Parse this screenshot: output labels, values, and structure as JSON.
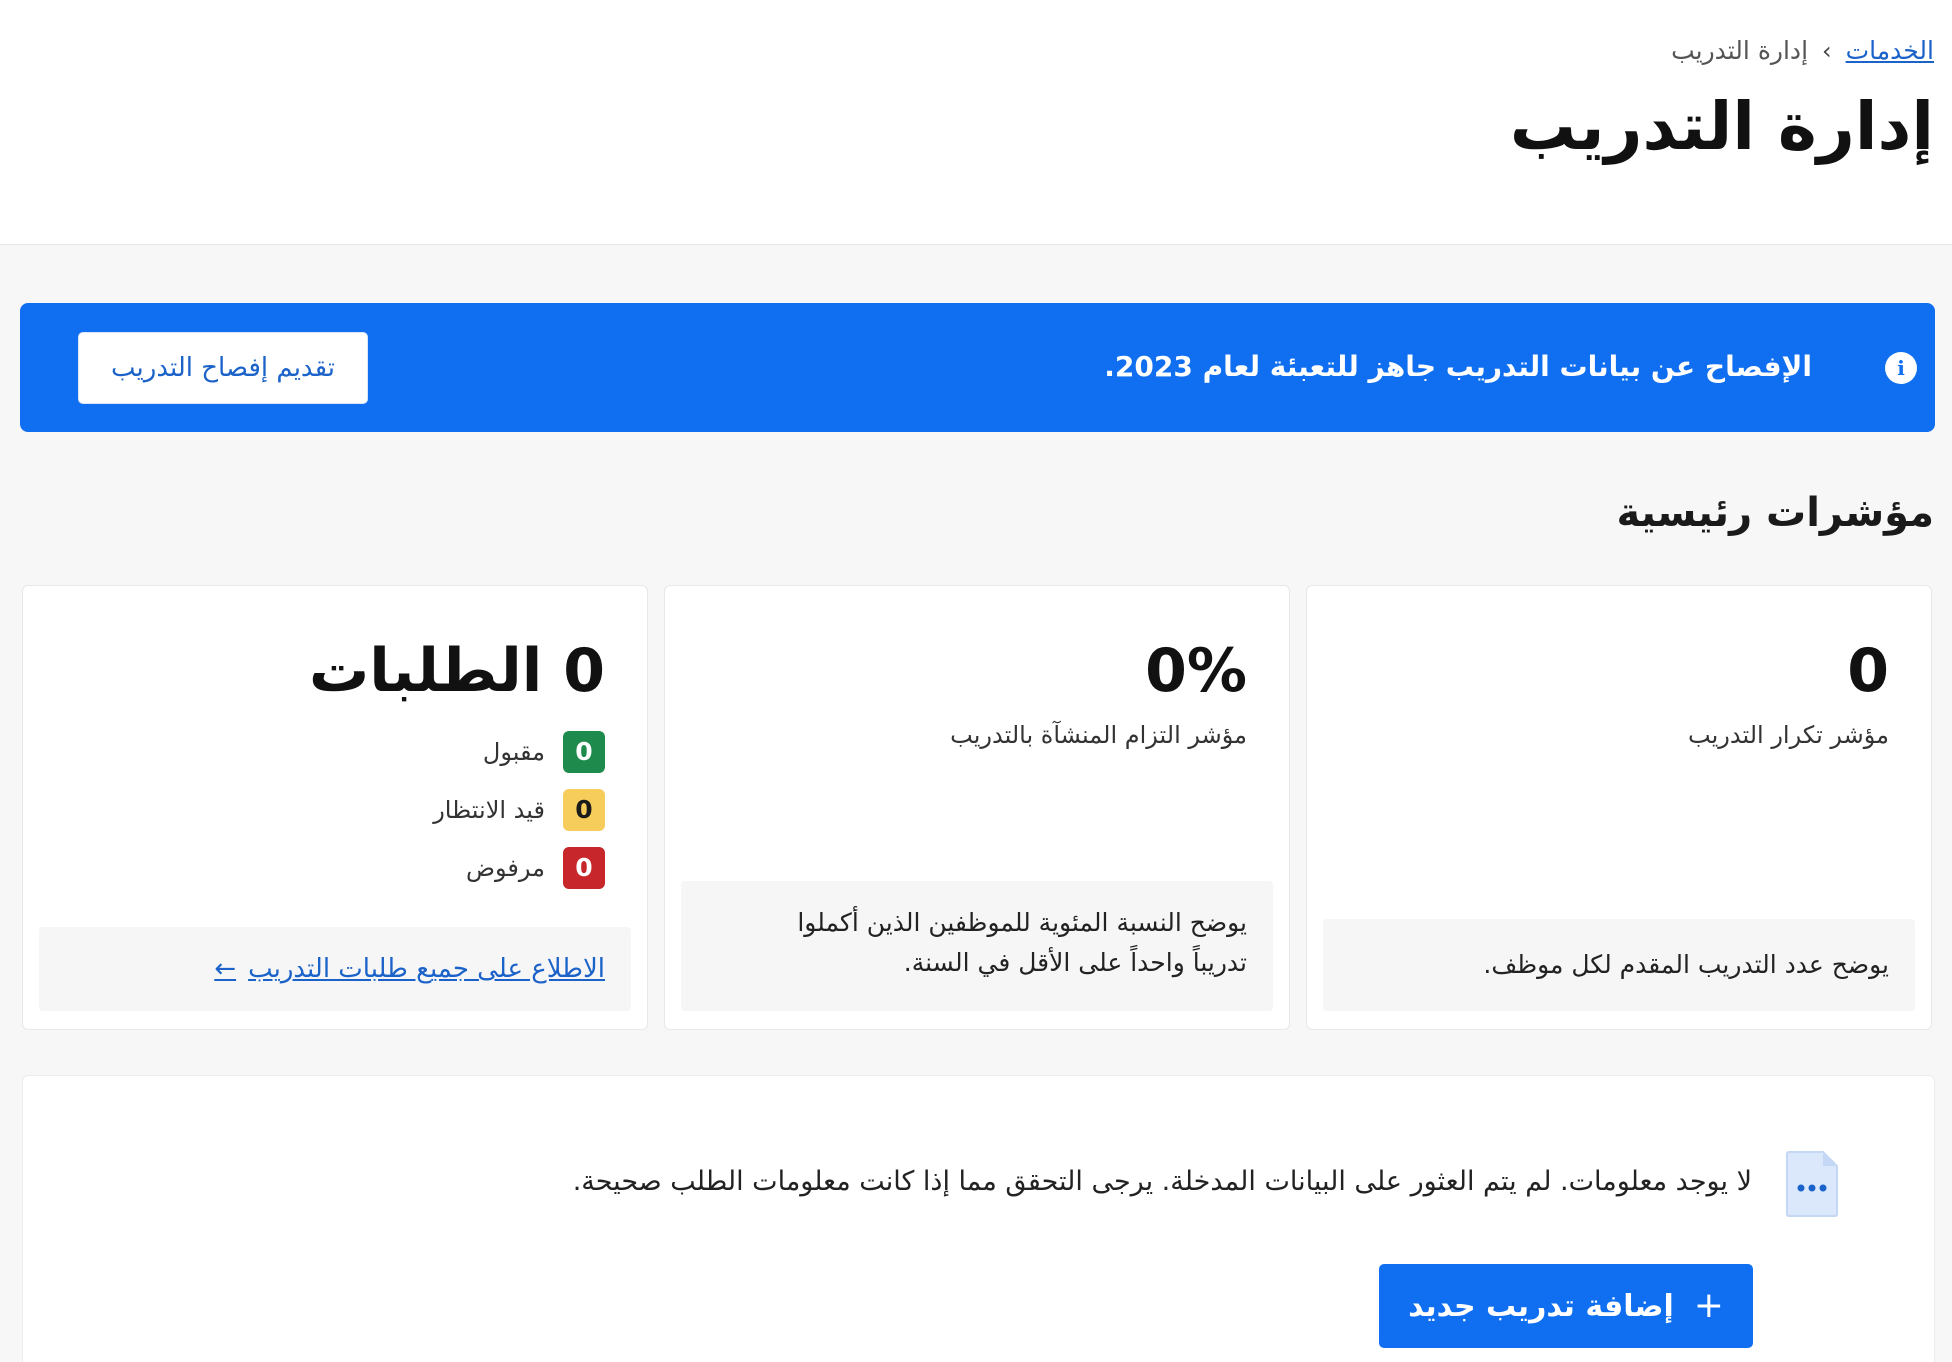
{
  "breadcrumb": {
    "home_label": "الخدمات",
    "separator": "›",
    "current_label": "إدارة التدريب"
  },
  "page": {
    "title": "إدارة التدريب"
  },
  "banner": {
    "icon": "info-icon",
    "text": "الإفصاح عن بيانات التدريب جاهز للتعبئة لعام 2023.",
    "button_label": "تقديم إفصاح التدريب",
    "color": "#0f6ff0"
  },
  "indicators": {
    "section_title": "مؤشرات رئيسية",
    "training_frequency": {
      "value": "0",
      "label": "مؤشر تكرار التدريب",
      "description": "يوضح عدد التدريب المقدم لكل موظف."
    },
    "training_commitment": {
      "value": "0%",
      "label": "مؤشر التزام المنشآة بالتدريب",
      "description_line1": "يوضح النسبة المئوية للموظفين الذين أكملوا",
      "description_line2": "تدريباً واحداً على الأقل في السنة."
    },
    "requests": {
      "value": "0 الطلبات",
      "statuses": [
        {
          "count": "0",
          "label": "مقبول",
          "color": "#1e8a4c"
        },
        {
          "count": "0",
          "label": "قيد الانتظار",
          "color": "#f6cc5b"
        },
        {
          "count": "0",
          "label": "مرفوض",
          "color": "#c7262b"
        }
      ],
      "link_label": "الاطلاع على جميع طلبات التدريب",
      "link_icon": "arrow-left-icon"
    }
  },
  "empty_state": {
    "icon": "document-icon",
    "message": "لا يوجد معلومات. لم يتم العثور على البيانات المدخلة. يرجى التحقق مما إذا كانت معلومات الطلب صحيحة.",
    "add_button_label": "إضافة تدريب جديد",
    "add_icon": "plus-icon"
  }
}
